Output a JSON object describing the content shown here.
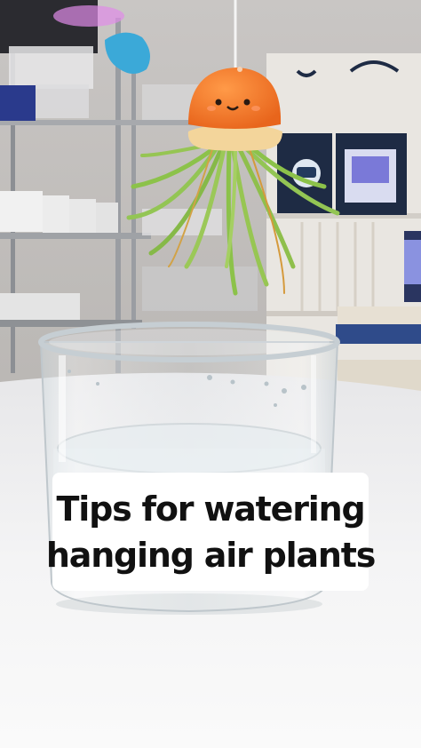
{
  "caption": {
    "line1": "Tips for watering",
    "line2": "hanging air plants"
  },
  "colors": {
    "jellyfish_cap": "#f07a2a",
    "plant_leaf": "#8cc24a",
    "counter": "#f2f1ef",
    "tote_bag": "#1e2b44"
  }
}
